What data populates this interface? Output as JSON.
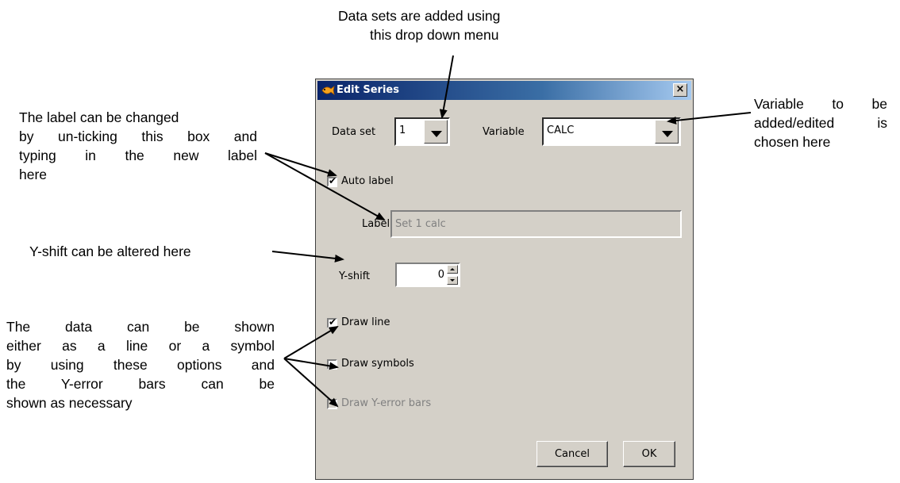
{
  "annotations": {
    "dataset_note": [
      "Data sets are added using",
      "this drop down menu"
    ],
    "label_note": [
      "The label can be changed",
      "by un-ticking this box and",
      "typing in the new label",
      "here"
    ],
    "variable_note": [
      "Variable to be",
      "added/edited is",
      "chosen here"
    ],
    "yshift_note": "Y-shift can be altered here",
    "draw_note": [
      "The data can be shown",
      "either as a line or a symbol",
      "by using these options and",
      "the Y-error bars can be",
      "shown as necessary"
    ]
  },
  "dialog": {
    "title": "Edit Series",
    "close_glyph": "×",
    "app_icon": "goldfish-icon",
    "dataset_label": "Data set",
    "dataset_value": "1",
    "variable_label": "Variable",
    "variable_value": "CALC",
    "auto_label": "Auto label",
    "auto_label_checked": true,
    "label_label": "Label",
    "label_value": "Set 1 calc",
    "yshift_label": "Y-shift",
    "yshift_value": "0",
    "draw_line": "Draw line",
    "draw_line_checked": true,
    "draw_symbols": "Draw symbols",
    "draw_symbols_checked": false,
    "draw_yerror": "Draw Y-error bars",
    "draw_yerror_enabled": false,
    "cancel": "Cancel",
    "ok": "OK"
  }
}
